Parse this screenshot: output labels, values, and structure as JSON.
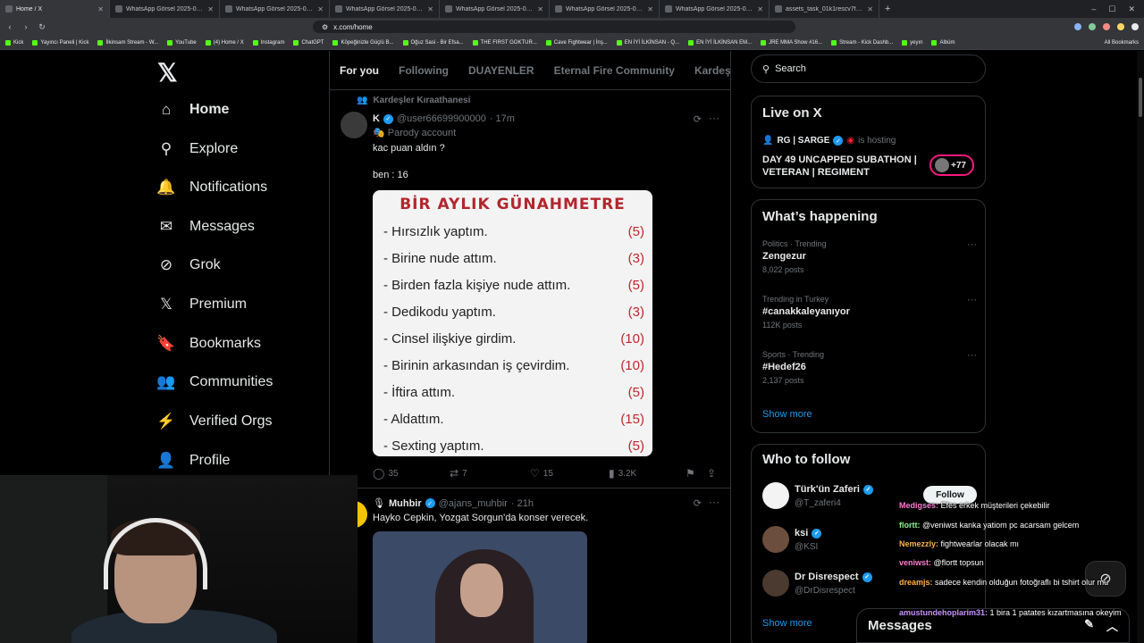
{
  "browser": {
    "tabs": [
      {
        "label": "Home / X",
        "active": true
      },
      {
        "label": "WhatsApp Görsel 2025-08-08 saat 2"
      },
      {
        "label": "WhatsApp Görsel 2025-08-09 saat 0"
      },
      {
        "label": "WhatsApp Görsel 2025-08-08 saat 2"
      },
      {
        "label": "WhatsApp Görsel 2025-08-09 saat 0"
      },
      {
        "label": "WhatsApp Görsel 2025-08-08 saat 2"
      },
      {
        "label": "WhatsApp Görsel 2025-08-08 saat 2"
      },
      {
        "label": "assets_task_01k1rescv7fe789e1psh"
      }
    ],
    "url": "x.com/home",
    "bookmarks": [
      "Kick",
      "Yayıncı Paneli | Kick",
      "İlkinsam Stream - W...",
      "YouTube",
      "(4) Home / X",
      "Instagram",
      "ChatGPT",
      "Köpeğinizle Güçlü B...",
      "Oğuz Sasi - Bir Efsa...",
      "THE FIRST GOKTUR...",
      "Cave Fightwear | İnş...",
      "EN İYİ İLKİNSAN - Q...",
      "EN İYİ İLKİNSAN EM...",
      "JRE MMA Show #16...",
      "Stream - Kick Dashb...",
      "yeyın",
      "Albüm"
    ],
    "all_bookmarks": "All Bookmarks"
  },
  "nav": {
    "items": [
      {
        "label": "Home",
        "icon": "home-icon",
        "glyph": "⌂"
      },
      {
        "label": "Explore",
        "icon": "search-icon",
        "glyph": "⚲"
      },
      {
        "label": "Notifications",
        "icon": "bell-icon",
        "glyph": "🔔"
      },
      {
        "label": "Messages",
        "icon": "envelope-icon",
        "glyph": "✉"
      },
      {
        "label": "Grok",
        "icon": "grok-icon",
        "glyph": "⊘"
      },
      {
        "label": "Premium",
        "icon": "x-logo-icon",
        "glyph": "𝕏"
      },
      {
        "label": "Bookmarks",
        "icon": "bookmark-icon",
        "glyph": "🔖"
      },
      {
        "label": "Communities",
        "icon": "communities-icon",
        "glyph": "👥"
      },
      {
        "label": "Verified Orgs",
        "icon": "lightning-icon",
        "glyph": "⚡"
      },
      {
        "label": "Profile",
        "icon": "person-icon",
        "glyph": "👤"
      }
    ]
  },
  "timeline": {
    "tabs": [
      "For you",
      "Following",
      "DUAYENLER",
      "Eternal Fire Community",
      "Kardeşler Kı"
    ],
    "post1": {
      "community": "Kardeşler Kıraathanesi",
      "name": "K",
      "handle": "@user66699900000",
      "time": "· 17m",
      "badge": "Parody account",
      "text1": "kac puan aldın ?",
      "text2": "ben : 16",
      "image": {
        "title": "BİR AYLIK GÜNAHMETRE",
        "rows": [
          {
            "item": "- Hırsızlık yaptım.",
            "score": "(5)"
          },
          {
            "item": "- Birine nude attım.",
            "score": "(3)"
          },
          {
            "item": "- Birden fazla kişiye nude attım.",
            "score": "(5)"
          },
          {
            "item": "- Dedikodu yaptım.",
            "score": "(3)"
          },
          {
            "item": "- Cinsel ilişkiye girdim.",
            "score": "(10)"
          },
          {
            "item": "- Birinin arkasından iş çevirdim.",
            "score": "(10)"
          },
          {
            "item": "- İftira attım.",
            "score": "(5)"
          },
          {
            "item": "- Aldattım.",
            "score": "(15)"
          },
          {
            "item": "- Sexting yaptım.",
            "score": "(5)"
          }
        ]
      },
      "replies": "35",
      "reposts": "7",
      "likes": "15",
      "views": "3.2K"
    },
    "post2": {
      "name": "Muhbir",
      "handle": "@ajans_muhbir",
      "time": "· 21h",
      "text": "Hayko Cepkin, Yozgat Sorgun'da konser verecek."
    }
  },
  "sidebar": {
    "search_placeholder": "Search",
    "live": {
      "title": "Live on X",
      "host": "RG | SARGE",
      "hosting": "is hosting",
      "stream_title": "DAY 49 UNCAPPED SUBATHON | VETERAN | REGIMENT",
      "listeners": "+77"
    },
    "happening": {
      "title": "What’s happening",
      "trends": [
        {
          "category": "Politics · Trending",
          "name": "Zengezur",
          "count": "8,022 posts"
        },
        {
          "category": "Trending in Turkey",
          "name": "#canakkaleyanıyor",
          "count": "112K posts"
        },
        {
          "category": "Sports · Trending",
          "name": "#Hedef26",
          "count": "2,137 posts"
        }
      ],
      "show_more": "Show more"
    },
    "who_to_follow": {
      "title": "Who to follow",
      "accounts": [
        {
          "name": "Türk'ün Zaferi",
          "handle": "@T_zaferi4"
        },
        {
          "name": "ksi",
          "handle": "@KSI"
        },
        {
          "name": "Dr Disrespect",
          "handle": "@DrDisrespect"
        }
      ],
      "follow_label": "Follow",
      "show_more": "Show more"
    }
  },
  "chat": {
    "messages": [
      {
        "user": "Medigses:",
        "text": " Efes erkek müşterileri çekebilir",
        "color": "#ff7bd0"
      },
      {
        "user": "flortt:",
        "text": " @veniwst kanka yatiom pc acarsam gelcem",
        "color": "#8ef08e"
      },
      {
        "user": "Nemezzly:",
        "text": " fightwearlar olacak mı",
        "color": "#ffb347"
      },
      {
        "user": "veniwst:",
        "text": " @flortt topsun",
        "color": "#ff7bd0"
      },
      {
        "user": "dreamjs:",
        "text": " sadece kendin olduğun fotoğraflı bi tshirt olur mu",
        "color": "#ffb347"
      },
      {
        "user": "amustundehoplarim31:",
        "text": " 1 bira 1 patates kızartmasına okeyim",
        "color": "#c792ff"
      }
    ]
  },
  "messages_drawer": {
    "label": "Messages"
  },
  "colors": {
    "accent": "#1d9bf0",
    "background": "#000000",
    "border": "#2f3336",
    "muted": "#71767b"
  }
}
